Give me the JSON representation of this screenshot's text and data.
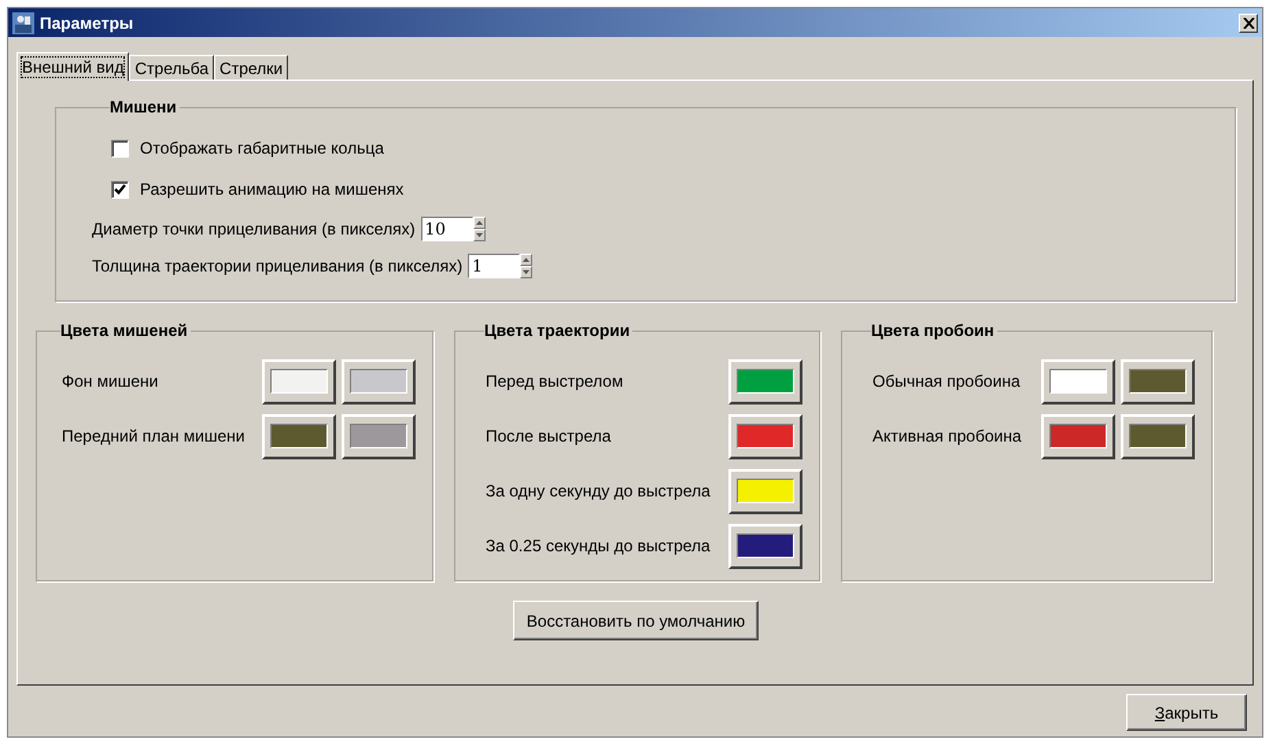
{
  "window": {
    "title": "Параметры"
  },
  "tabs": [
    {
      "label": "Внешний вид",
      "selected": true
    },
    {
      "label": "Стрельба",
      "selected": false
    },
    {
      "label": "Стрелки",
      "selected": false
    }
  ],
  "targets_group": {
    "title": "Мишени",
    "checkboxes": [
      {
        "label": "Отображать габаритные кольца",
        "checked": false
      },
      {
        "label": "Разрешить анимацию на мишенях",
        "checked": true
      }
    ],
    "spinners": [
      {
        "label": "Диаметр точки прицеливания (в пикселях)",
        "value": "10"
      },
      {
        "label": "Толщина траектории прицеливания (в пикселях)",
        "value": "1"
      }
    ]
  },
  "color_groups": [
    {
      "title": "Цвета мишеней",
      "rows": [
        {
          "label": "Фон мишени",
          "swatches": [
            {
              "color": "#f2f2f0"
            },
            {
              "color": "#c8c8cc"
            }
          ]
        },
        {
          "label": "Передний план мишени",
          "swatches": [
            {
              "color": "#5e5a30"
            },
            {
              "color": "#9c989c"
            }
          ]
        }
      ]
    },
    {
      "title": "Цвета траектории",
      "rows": [
        {
          "label": "Перед выстрелом",
          "swatches": [
            {
              "color": "#00a040"
            }
          ]
        },
        {
          "label": "После выстрела",
          "swatches": [
            {
              "color": "#e02828"
            }
          ]
        },
        {
          "label": "За одну секунду до выстрела",
          "swatches": [
            {
              "color": "#f4f000"
            }
          ]
        },
        {
          "label": "За 0.25 секунды до выстрела",
          "swatches": [
            {
              "color": "#241c7c"
            }
          ]
        }
      ]
    },
    {
      "title": "Цвета пробоин",
      "rows": [
        {
          "label": "Обычная пробоина",
          "swatches": [
            {
              "color": "#ffffff"
            },
            {
              "color": "#5e5a30"
            }
          ]
        },
        {
          "label": "Активная пробоина",
          "swatches": [
            {
              "color": "#cc2828"
            },
            {
              "color": "#5e5a30"
            }
          ]
        }
      ]
    }
  ],
  "restore_button": "Восстановить по умолчанию",
  "close_button": {
    "label": "Закрыть",
    "underline_first_letter": true
  }
}
